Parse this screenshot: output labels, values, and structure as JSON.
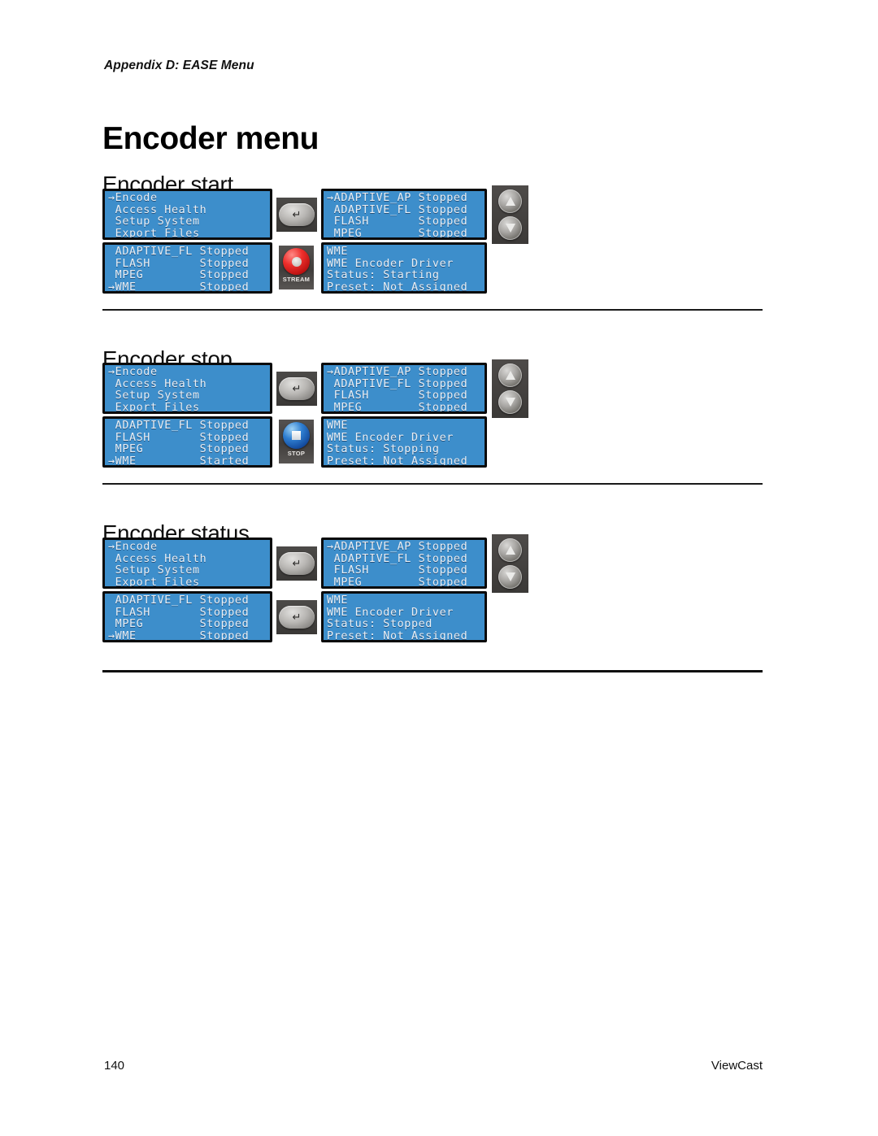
{
  "document": {
    "running_head": "Appendix D: EASE Menu",
    "title": "Encoder menu",
    "footer": {
      "page_number": "140",
      "brand": "ViewCast"
    }
  },
  "colors": {
    "lcd_background": "#3d8ecb",
    "lcd_text": "#e9eef4",
    "lcd_border": "#0a0a0a",
    "button_body": "#403d3b",
    "stream_red": "#ee2f2c",
    "stop_blue": "#2f7fd1",
    "rule": "#1a1a1a",
    "page_background": "#ffffff"
  },
  "sections": [
    {
      "heading": "Encoder start",
      "rule_above": false,
      "rows": [
        {
          "lcd_left": {
            "name": "main-menu-panel",
            "lines": [
              "→Encode",
              " Access Health",
              " Setup System",
              " Export Files"
            ]
          },
          "button": {
            "name": "enter-button",
            "type": "enter",
            "glyph": "↵",
            "label": ""
          },
          "lcd_right": {
            "name": "encoder-list-panel",
            "lines": [
              "→ADAPTIVE_AP Stopped",
              " ADAPTIVE_FL Stopped",
              " FLASH       Stopped",
              " MPEG        Stopped"
            ]
          },
          "arrows": {
            "name": "up-down-arrow-buttons",
            "up": "up-arrow-icon",
            "down": "down-arrow-icon"
          }
        },
        {
          "lcd_left": {
            "name": "encoder-list-scrolled-panel",
            "lines": [
              " ADAPTIVE_FL Stopped",
              " FLASH       Stopped",
              " MPEG        Stopped",
              "→WME         Stopped"
            ]
          },
          "button": {
            "name": "stream-button",
            "type": "stream",
            "glyph": "",
            "label": "STREAM"
          },
          "lcd_right": {
            "name": "wme-status-panel",
            "lines": [
              "WME",
              "WME Encoder Driver",
              "Status: Starting",
              "Preset: Not Assigned"
            ]
          },
          "arrows": null
        }
      ]
    },
    {
      "heading": "Encoder stop",
      "rule_above": true,
      "rows": [
        {
          "lcd_left": {
            "name": "main-menu-panel",
            "lines": [
              "→Encode",
              " Access Health",
              " Setup System",
              " Export Files"
            ]
          },
          "button": {
            "name": "enter-button",
            "type": "enter",
            "glyph": "↵",
            "label": ""
          },
          "lcd_right": {
            "name": "encoder-list-panel",
            "lines": [
              "→ADAPTIVE_AP Stopped",
              " ADAPTIVE_FL Stopped",
              " FLASH       Stopped",
              " MPEG        Stopped"
            ]
          },
          "arrows": {
            "name": "up-down-arrow-buttons",
            "up": "up-arrow-icon",
            "down": "down-arrow-icon"
          }
        },
        {
          "lcd_left": {
            "name": "encoder-list-scrolled-panel",
            "lines": [
              " ADAPTIVE_FL Stopped",
              " FLASH       Stopped",
              " MPEG        Stopped",
              "→WME         Started"
            ]
          },
          "button": {
            "name": "stop-button",
            "type": "stop",
            "glyph": "",
            "label": "STOP"
          },
          "lcd_right": {
            "name": "wme-status-panel",
            "lines": [
              "WME",
              "WME Encoder Driver",
              "Status: Stopping",
              "Preset: Not Assigned"
            ]
          },
          "arrows": null
        }
      ]
    },
    {
      "heading": "Encoder status",
      "rule_above": true,
      "rows": [
        {
          "lcd_left": {
            "name": "main-menu-panel",
            "lines": [
              "→Encode",
              " Access Health",
              " Setup System",
              " Export Files"
            ]
          },
          "button": {
            "name": "enter-button",
            "type": "enter",
            "glyph": "↵",
            "label": ""
          },
          "lcd_right": {
            "name": "encoder-list-panel",
            "lines": [
              "→ADAPTIVE_AP Stopped",
              " ADAPTIVE_FL Stopped",
              " FLASH       Stopped",
              " MPEG        Stopped"
            ]
          },
          "arrows": {
            "name": "up-down-arrow-buttons",
            "up": "up-arrow-icon",
            "down": "down-arrow-icon"
          }
        },
        {
          "lcd_left": {
            "name": "encoder-list-scrolled-panel",
            "lines": [
              " ADAPTIVE_FL Stopped",
              " FLASH       Stopped",
              " MPEG        Stopped",
              "→WME         Stopped"
            ]
          },
          "button": {
            "name": "enter-button",
            "type": "enter",
            "glyph": "↵",
            "label": ""
          },
          "lcd_right": {
            "name": "wme-status-panel",
            "lines": [
              "WME",
              "WME Encoder Driver",
              "Status: Stopped",
              "Preset: Not Assigned"
            ]
          },
          "arrows": null
        }
      ]
    }
  ],
  "layout": {
    "section_tops": [
      190,
      405,
      619
    ],
    "heading_offsets": [
      0,
      0,
      0
    ],
    "group_tops": [
      232,
      446,
      661
    ],
    "rule_tops": [
      392,
      607,
      824
    ]
  }
}
